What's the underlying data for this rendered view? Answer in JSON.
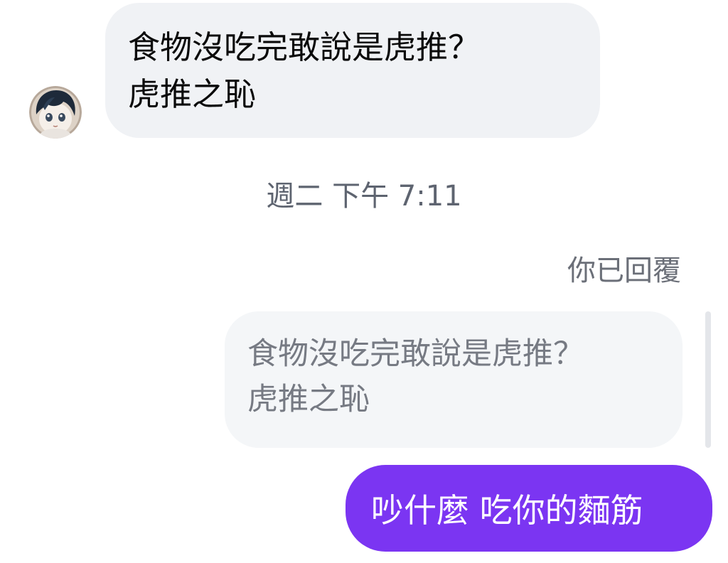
{
  "incoming_message": {
    "lines": [
      "食物沒吃完敢說是虎推？",
      "虎推之恥"
    ]
  },
  "timestamp": "週二 下午 7:11",
  "reply_label": "你已回覆",
  "quoted_message": {
    "lines": [
      "食物沒吃完敢說是虎推？",
      "虎推之恥"
    ]
  },
  "outgoing_message": {
    "text": "吵什麼 吃你的麵筋"
  },
  "colors": {
    "outgoing_bubble": "#7b35f2",
    "incoming_bubble": "#f0f2f5",
    "quoted_bubble": "#f4f6f8"
  },
  "icons": {
    "avatar": "user-avatar"
  }
}
